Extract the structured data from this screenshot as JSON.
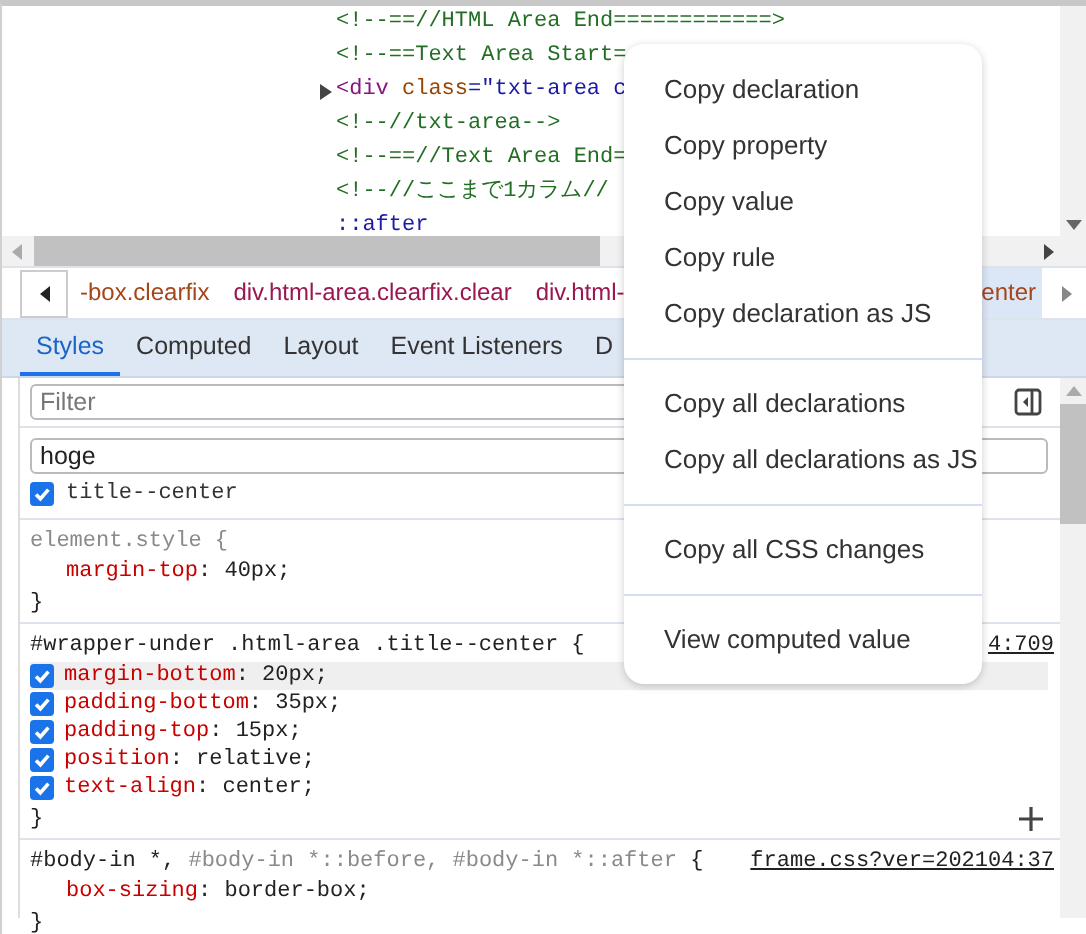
{
  "dom_lines": [
    {
      "expandable": false,
      "parts": [
        {
          "kind": "comment",
          "text": "<!--==//HTML Area End============>"
        }
      ]
    },
    {
      "expandable": false,
      "parts": [
        {
          "kind": "comment",
          "text": "<!--==Text Area Start="
        }
      ]
    },
    {
      "expandable": true,
      "parts": [
        {
          "kind": "tag",
          "text": "<div"
        },
        {
          "kind": "attr",
          "text": " class"
        },
        {
          "kind": "value",
          "text": "=\"txt-area c"
        }
      ]
    },
    {
      "expandable": false,
      "parts": [
        {
          "kind": "comment",
          "text": "<!--//txt-area-->"
        }
      ]
    },
    {
      "expandable": false,
      "parts": [
        {
          "kind": "comment",
          "text": "<!--==//Text Area End="
        }
      ]
    },
    {
      "expandable": false,
      "parts": [
        {
          "kind": "comment",
          "text": "<!--//ここまで1カラム//"
        }
      ]
    },
    {
      "expandable": false,
      "parts": [
        {
          "kind": "pseudo",
          "text": "::after"
        }
      ]
    }
  ],
  "breadcrumbs": [
    {
      "label": "-box.clearfix",
      "selected": false
    },
    {
      "label": "div.html-area.clearfix.clear",
      "selected": false
    },
    {
      "label": "div.html-",
      "selected": false
    },
    {
      "label": "enter",
      "selected": true
    }
  ],
  "tabs": [
    {
      "label": "Styles",
      "selected": true
    },
    {
      "label": "Computed",
      "selected": false
    },
    {
      "label": "Layout",
      "selected": false
    },
    {
      "label": "Event Listeners",
      "selected": false
    },
    {
      "label": "D",
      "selected": false
    }
  ],
  "filter": {
    "placeholder": "Filter"
  },
  "class_input": {
    "value": "hoge"
  },
  "classes": [
    {
      "label": "title--center",
      "checked": true
    }
  ],
  "rules": [
    {
      "selector_parts": [
        {
          "kind": "inactive",
          "text": "element.style {"
        }
      ],
      "declarations": [
        {
          "name": "margin-top",
          "value": ": 40px;"
        }
      ],
      "close": "}",
      "add_button": false
    },
    {
      "selector_parts": [
        {
          "kind": "active",
          "text": "#wrapper-under .html-area .title--center {"
        }
      ],
      "source": "4:709",
      "declarations": [
        {
          "name": "margin-bottom",
          "value": ": 20px;",
          "checked": true,
          "hovered": true
        },
        {
          "name": "padding-bottom",
          "value": ": 35px;",
          "checked": true,
          "hovered": false
        },
        {
          "name": "padding-top",
          "value": ": 15px;",
          "checked": true,
          "hovered": false
        },
        {
          "name": "position",
          "value": ": relative;",
          "checked": true,
          "hovered": false
        },
        {
          "name": "text-align",
          "value": ": center;",
          "checked": true,
          "hovered": false
        }
      ],
      "close": "}",
      "add_button": true
    },
    {
      "selector_parts": [
        {
          "kind": "active",
          "text": "#body-in *,"
        },
        {
          "kind": "inactive",
          "text": " #body-in *::before, #body-in *::after"
        },
        {
          "kind": "active",
          "text": " {"
        }
      ],
      "source": "frame.css?ver=202104:37",
      "declarations": [
        {
          "name": "box-sizing",
          "value": ": border-box;"
        }
      ],
      "close": "}",
      "add_button": false
    }
  ],
  "context_menu": {
    "groups": [
      [
        "Copy declaration",
        "Copy property",
        "Copy value",
        "Copy rule",
        "Copy declaration as JS"
      ],
      [
        "Copy all declarations",
        "Copy all declarations as JS"
      ],
      [
        "Copy all CSS changes"
      ],
      [
        "View computed value"
      ]
    ]
  }
}
